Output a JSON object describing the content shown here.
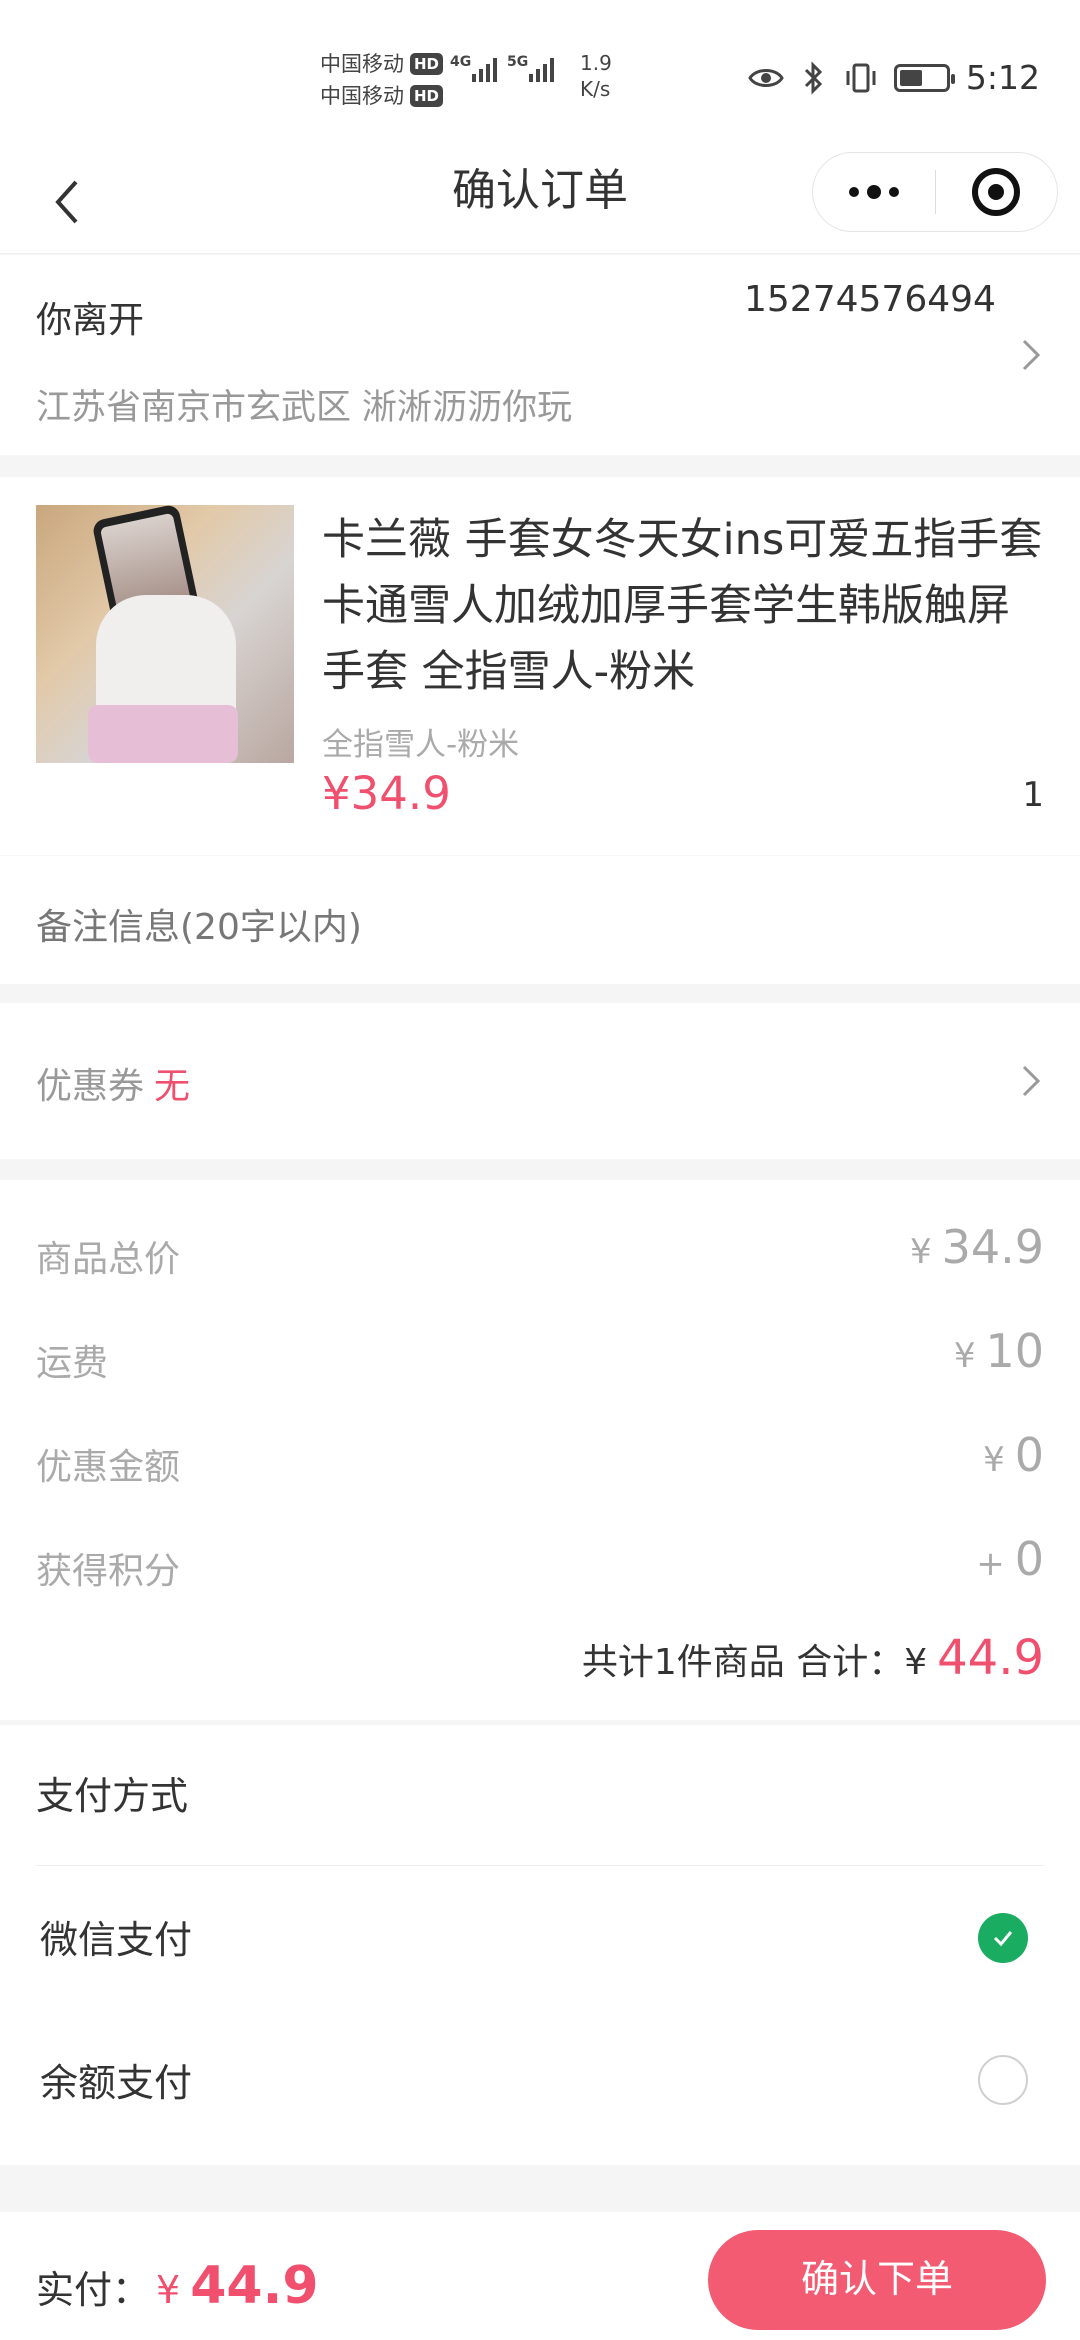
{
  "status_bar": {
    "carrier1": "中国移动",
    "carrier2": "中国移动",
    "hd": "HD",
    "net1": "4G",
    "net2": "5G",
    "speed_value": "1.9",
    "speed_unit": "K/s",
    "battery_level": 0.5,
    "time": "5:12"
  },
  "nav": {
    "title": "确认订单"
  },
  "address": {
    "name": "你离开",
    "phone": "15274576494",
    "detail": "江苏省南京市玄武区 淅淅沥沥你玩"
  },
  "product": {
    "title": "卡兰薇 手套女冬天女ins可爱五指手套卡通雪人加绒加厚手套学生韩版触屏手套 全指雪人-粉米",
    "spec": "全指雪人-粉米",
    "price": "¥34.9",
    "quantity": "1"
  },
  "remark": {
    "placeholder": "备注信息(20字以内)"
  },
  "coupon": {
    "label": "优惠券",
    "value": "无"
  },
  "summary": {
    "currency": "¥",
    "rows": [
      {
        "label": "商品总价",
        "prefix": "¥",
        "value": "34.9"
      },
      {
        "label": "运费",
        "prefix": "¥",
        "value": "10"
      },
      {
        "label": "优惠金额",
        "prefix": "¥",
        "value": "0"
      },
      {
        "label": "获得积分",
        "prefix": "+",
        "value": "0"
      }
    ],
    "total_label": "共计1件商品 合计：¥",
    "total_value": "44.9"
  },
  "payment": {
    "title": "支付方式",
    "options": [
      {
        "label": "微信支付",
        "selected": true
      },
      {
        "label": "余额支付",
        "selected": false
      }
    ]
  },
  "footer": {
    "pay_label": "实付：",
    "currency": "¥",
    "amount": "44.9",
    "submit_label": "确认下单"
  },
  "colors": {
    "accent": "#f0506e",
    "button": "#f35b73",
    "check": "#1aad61"
  }
}
